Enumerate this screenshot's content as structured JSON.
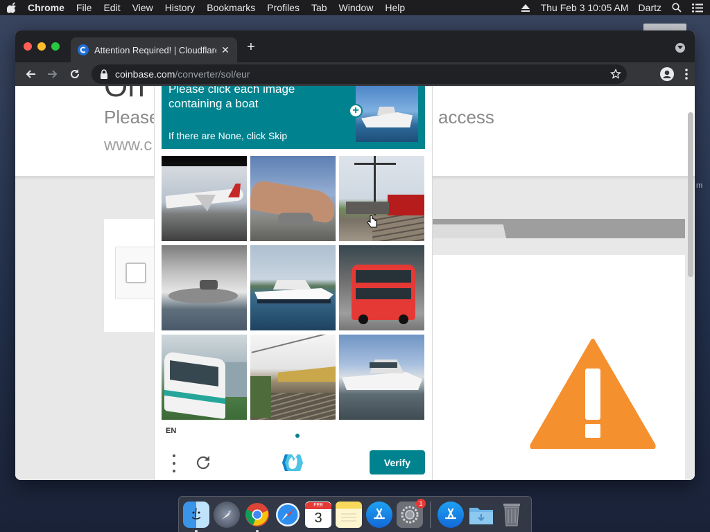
{
  "menubar": {
    "app": "Chrome",
    "items": [
      "File",
      "Edit",
      "View",
      "History",
      "Bookmarks",
      "Profiles",
      "Tab",
      "Window",
      "Help"
    ],
    "clock": "Thu Feb 3  10:05 AM",
    "user": "Dartz"
  },
  "browser": {
    "tab_title": "Attention Required! | Cloudflare",
    "url_host": "coinbase.com",
    "url_path": "/converter/sol/eur"
  },
  "page": {
    "big_title": "Oh",
    "please_text": "Please",
    "www_text": "www.c",
    "access_text": "access",
    "desk_text": "m"
  },
  "captcha": {
    "prompt_line1": "Please click each image containing a boat",
    "prompt_line2": "If there are None, click Skip",
    "language": "EN",
    "verify_label": "Verify",
    "images": [
      {
        "label": "airplane taking off",
        "type": "plane"
      },
      {
        "label": "airplane on runway",
        "type": "plane2"
      },
      {
        "label": "train on tracks",
        "type": "train"
      },
      {
        "label": "boat in water spray",
        "type": "boat-spray"
      },
      {
        "label": "yacht on water",
        "type": "yacht"
      },
      {
        "label": "red double-decker bus",
        "type": "bus"
      },
      {
        "label": "passenger train",
        "type": "train2"
      },
      {
        "label": "railway platform",
        "type": "rail"
      },
      {
        "label": "motor yacht",
        "type": "yacht2"
      }
    ]
  },
  "dock": {
    "apps": [
      "Finder",
      "Launchpad",
      "Chrome",
      "Safari",
      "Calendar",
      "Notes",
      "App Store",
      "System Preferences",
      "App Store",
      "Downloads",
      "Trash"
    ],
    "calendar_month": "FEB",
    "calendar_day": "3",
    "sysprefs_badge": "1"
  }
}
